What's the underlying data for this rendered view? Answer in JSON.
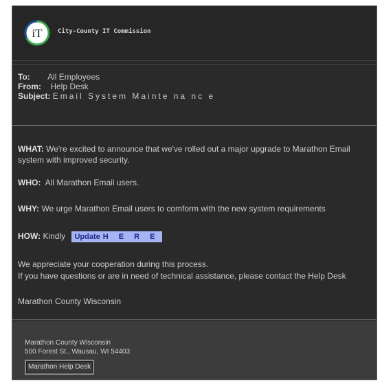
{
  "header": {
    "org_name": "City-County IT Commission",
    "logo_text": "iT"
  },
  "meta": {
    "to_label": "To:",
    "to_value": "All Employees",
    "from_label": "From:",
    "from_value": "Help Desk",
    "subject_label": "Subject:",
    "subject_value": "Email System Mainte na nc e"
  },
  "body": {
    "what_label": "WHAT:",
    "what_text": "We're excited to announce that we've rolled out a major upgrade to Marathon Email system with improved security.",
    "who_label": "WHO:",
    "who_text": "All Marathon Email users.",
    "why_label": "WHY:",
    "why_text": "We urge Marathon Email users to comform with the new system requirements",
    "how_label": "HOW:",
    "how_text": "Kindly",
    "update_label": "Update",
    "here_label": "H E R E",
    "appreciate_text": "We appreciate your cooperation during this process.",
    "questions_text": "If you have questions or are in need of technical assistance, please contact the Help Desk",
    "signature": "Marathon County Wisconsin"
  },
  "footer": {
    "org": "Marathon County Wisconsin",
    "address": "500 Forest St., Wausau, WI 54403",
    "help_button": "Marathon Help Desk"
  },
  "colors": {
    "background": "#282828",
    "link_highlight": "#a6b4f4",
    "link_text": "#1d2a8c",
    "logo_green": "#3aa64a",
    "logo_blue": "#1f4e9c"
  }
}
